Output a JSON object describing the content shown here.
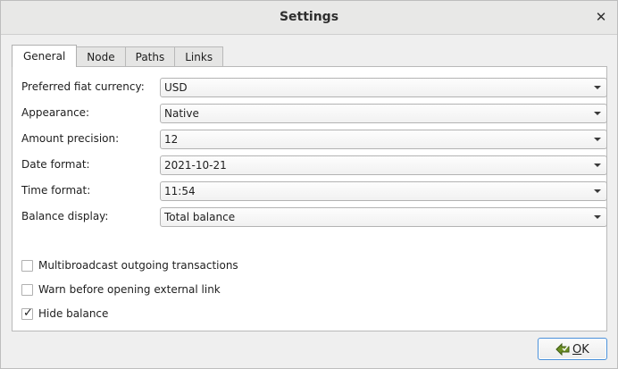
{
  "window": {
    "title": "Settings",
    "close_symbol": "✕"
  },
  "tabs": [
    {
      "label": "General",
      "active": true
    },
    {
      "label": "Node",
      "active": false
    },
    {
      "label": "Paths",
      "active": false
    },
    {
      "label": "Links",
      "active": false
    }
  ],
  "general": {
    "fields": [
      {
        "label": "Preferred fiat currency:",
        "value": "USD"
      },
      {
        "label": "Appearance:",
        "value": "Native"
      },
      {
        "label": "Amount precision:",
        "value": "12"
      },
      {
        "label": "Date format:",
        "value": "2021-10-21"
      },
      {
        "label": "Time format:",
        "value": "11:54"
      },
      {
        "label": "Balance display:",
        "value": "Total balance"
      }
    ],
    "checkboxes": [
      {
        "label": "Multibroadcast outgoing transactions",
        "checked": false
      },
      {
        "label": "Warn before opening external link",
        "checked": false
      },
      {
        "label": "Hide balance",
        "checked": true
      }
    ]
  },
  "footer": {
    "ok_label": "OK",
    "ok_icon": "check-arrow-icon"
  },
  "colors": {
    "focus_border": "#4a90d9",
    "ok_icon_fill": "#6b8e23"
  }
}
